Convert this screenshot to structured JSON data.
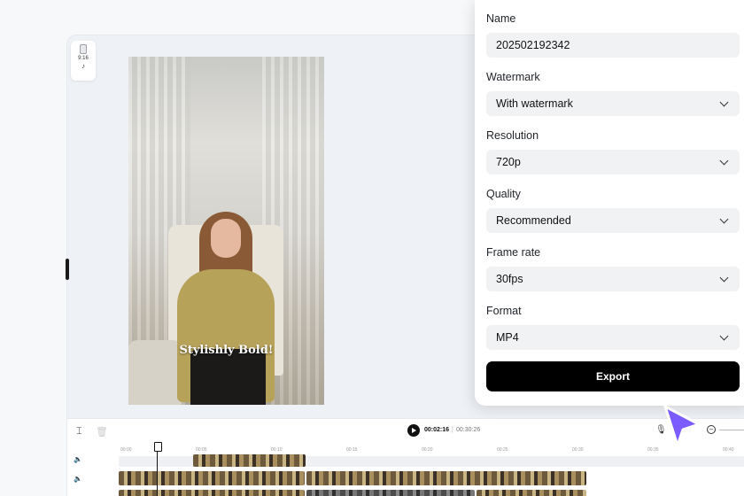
{
  "editor": {
    "ratio_label": "9:16",
    "caption": "Stylishly Bold!"
  },
  "timeline": {
    "current_time": "00:02:16",
    "separator": "|",
    "total_time": "00:30:26",
    "ruler_ticks": [
      "00:00",
      "00:05",
      "00:10",
      "00:15",
      "00:20",
      "00:25",
      "00:30",
      "00:35",
      "00:40"
    ]
  },
  "export_panel": {
    "name_label": "Name",
    "name_value": "202502192342",
    "watermark_label": "Watermark",
    "watermark_value": "With watermark",
    "resolution_label": "Resolution",
    "resolution_value": "720p",
    "quality_label": "Quality",
    "quality_value": "Recommended",
    "framerate_label": "Frame rate",
    "framerate_value": "30fps",
    "format_label": "Format",
    "format_value": "MP4",
    "export_button": "Export"
  },
  "icons": {
    "ratio": "phone-portrait-icon",
    "platform": "tiktok-icon",
    "split": "split-icon",
    "delete": "trash-icon",
    "play": "play-icon",
    "mic": "microphone-icon",
    "zoom_out": "zoom-out-icon",
    "audio_track": "speaker-icon",
    "cursor": "pointer-cursor-icon"
  },
  "colors": {
    "export_button": "#000000",
    "cursor": "#7b5cff",
    "field_bg": "#f0f2f4"
  }
}
